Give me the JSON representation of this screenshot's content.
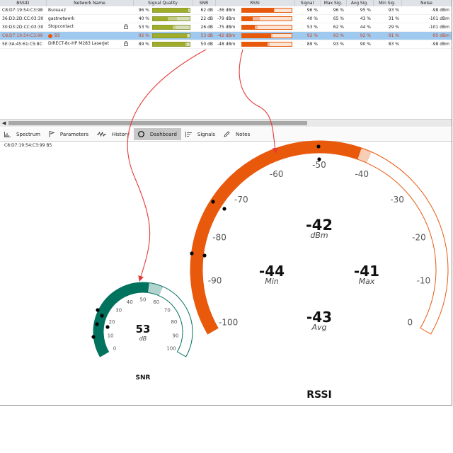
{
  "table": {
    "headers": [
      "BSSID",
      "Network Name",
      "Signal Quality",
      "SNR",
      "RSSI",
      "Signal",
      "Max Sig.",
      "Avg Sig.",
      "Min Sig.",
      "Noise"
    ],
    "rows": [
      {
        "bssid": "C8:D7:19:54:C3:98",
        "name": "Bureau2",
        "lock": false,
        "dot": false,
        "quality_text": "96 %",
        "quality": 0.96,
        "quality_peak": 0.96,
        "snr": "62 dB",
        "rssi": "-36 dBm",
        "rssi_frac": 0.64,
        "rssi_peak": 0.64,
        "signal": "96 %",
        "max": "96 %",
        "avg": "95 %",
        "min": "93 %",
        "noise": "-98 dBm"
      },
      {
        "bssid": "36:D3:2D:CC:03:30",
        "name": "gastnetwerk",
        "lock": false,
        "dot": false,
        "quality_text": "40 %",
        "quality": 0.4,
        "quality_peak": 0.65,
        "snr": "22 dB",
        "rssi": "-79 dBm",
        "rssi_frac": 0.21,
        "rssi_peak": 0.35,
        "signal": "40 %",
        "max": "65 %",
        "avg": "43 %",
        "min": "31 %",
        "noise": "-101 dBm"
      },
      {
        "bssid": "30:D3:2D:CC:03:30",
        "name": "Stopcontact",
        "lock": true,
        "dot": false,
        "quality_text": "53 %",
        "quality": 0.53,
        "quality_peak": 0.62,
        "snr": "26 dB",
        "rssi": "-75 dBm",
        "rssi_frac": 0.25,
        "rssi_peak": 0.3,
        "signal": "53 %",
        "max": "62 %",
        "avg": "44 %",
        "min": "29 %",
        "noise": "-101 dBm"
      },
      {
        "bssid": "C8:D7:19:54:C3:99",
        "name": "B5",
        "lock": false,
        "dot": true,
        "quality_text": "92 %",
        "quality": 0.92,
        "quality_peak": 0.93,
        "snr": "53 dB",
        "rssi": "-42 dBm",
        "rssi_frac": 0.58,
        "rssi_peak": 0.6,
        "signal": "92 %",
        "max": "93 %",
        "avg": "92 %",
        "min": "91 %",
        "noise": "-95 dBm",
        "selected": true
      },
      {
        "bssid": "5E:3A:45:61:C5:8C",
        "name": "DIRECT-8c-HP M283 LaserJet",
        "lock": true,
        "dot": false,
        "quality_text": "89 %",
        "quality": 0.89,
        "quality_peak": 0.93,
        "snr": "50 dB",
        "rssi": "-48 dBm",
        "rssi_frac": 0.52,
        "rssi_peak": 0.55,
        "signal": "89 %",
        "max": "93 %",
        "avg": "90 %",
        "min": "83 %",
        "noise": "-98 dBm"
      }
    ]
  },
  "tabs": [
    {
      "label": "Spectrum",
      "icon": "spectrum-icon"
    },
    {
      "label": "Parameters",
      "icon": "flag-icon"
    },
    {
      "label": "History",
      "icon": "history-icon"
    },
    {
      "label": "Dashboard",
      "icon": "dashboard-icon",
      "active": true
    },
    {
      "label": "Signals",
      "icon": "signals-icon"
    },
    {
      "label": "Notes",
      "icon": "pencil-icon"
    }
  ],
  "dashboard": {
    "caption": "C8:D7:19:54:C3:99   B5",
    "snr": {
      "title": "SNR",
      "value": "53",
      "unit": "dB",
      "min": 0,
      "max": 100,
      "current": 53,
      "history_max": 60,
      "history_min": 25,
      "ticks": [
        "0",
        "10",
        "20",
        "30",
        "40",
        "50",
        "60",
        "70",
        "80",
        "90",
        "100"
      ],
      "color": "#00725e"
    },
    "rssi": {
      "title": "RSSI",
      "value": "-42",
      "unit": "dBm",
      "min": -100,
      "max": 0,
      "current": -42,
      "history_max": -40,
      "ticks": [
        "-100",
        "-90",
        "-80",
        "-70",
        "-60",
        "-50",
        "-40",
        "-30",
        "-20",
        "-10",
        "0"
      ],
      "stats": [
        {
          "value": "-44",
          "label": "Min"
        },
        {
          "value": "-41",
          "label": "Max"
        },
        {
          "value": "-43",
          "label": "Avg"
        }
      ],
      "color": "#e8590c"
    }
  },
  "colors": {
    "annotation": "#e53935"
  }
}
